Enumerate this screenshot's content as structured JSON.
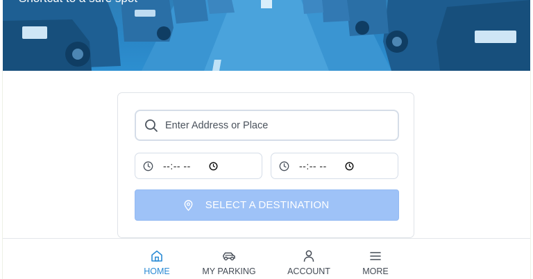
{
  "hero": {
    "tagline": "Shortcut to a sure spot"
  },
  "search": {
    "placeholder": "Enter Address or Place",
    "value": ""
  },
  "time": {
    "start_value": "--:-- --",
    "end_value": "--:-- --"
  },
  "destination_button": {
    "label": "SELECT A DESTINATION",
    "icon": "map-pin-icon"
  },
  "nav": {
    "items": [
      {
        "label": "HOME",
        "icon": "home-icon",
        "active": true
      },
      {
        "label": "MY PARKING",
        "icon": "car-icon",
        "active": false
      },
      {
        "label": "ACCOUNT",
        "icon": "user-icon",
        "active": false
      },
      {
        "label": "MORE",
        "icon": "menu-icon",
        "active": false
      }
    ]
  },
  "colors": {
    "accent": "#2a8bd5",
    "button_disabled": "#9ec2f7",
    "hero": "#2a86c6"
  }
}
